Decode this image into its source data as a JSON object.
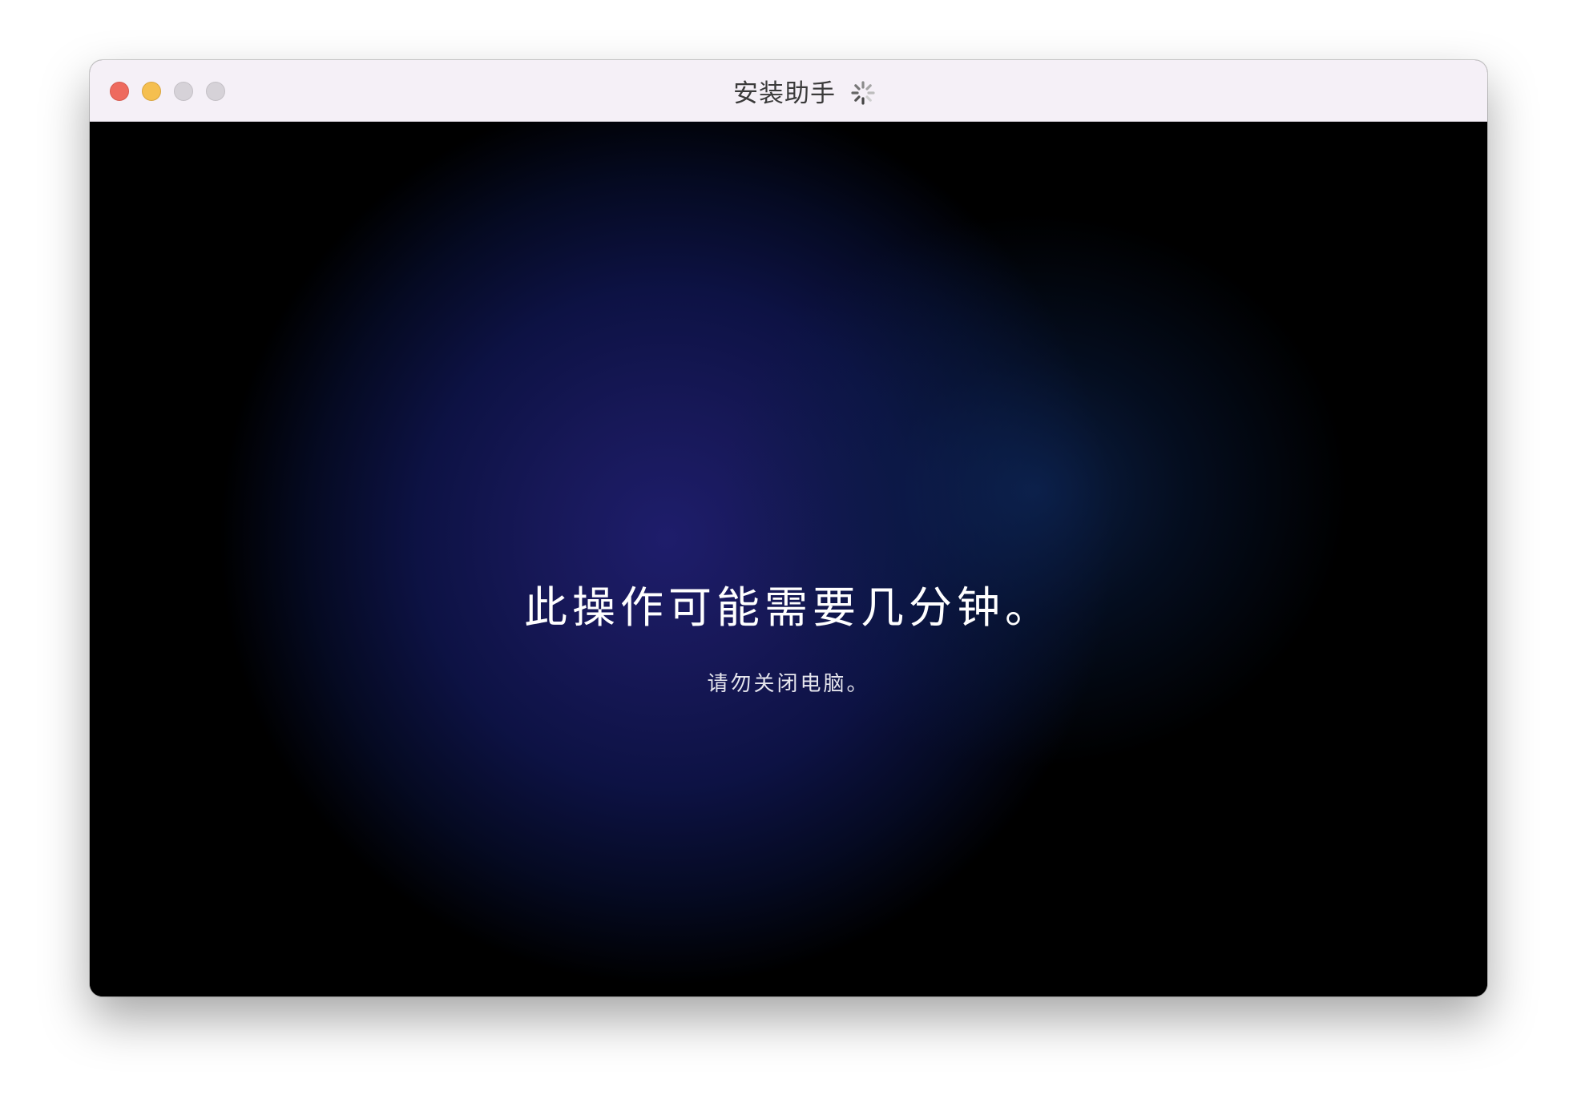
{
  "window": {
    "title": "安装助手",
    "spinner_icon": "activity-spinner-icon"
  },
  "main": {
    "headline": "此操作可能需要几分钟。",
    "subtext": "请勿关闭电脑。"
  },
  "colors": {
    "close": "#ee6a5e",
    "minimize": "#f5bf4f",
    "inactive": "#d6d2d8",
    "titlebar": "#f5f0f7",
    "background_glow": "#1e1d6b"
  }
}
